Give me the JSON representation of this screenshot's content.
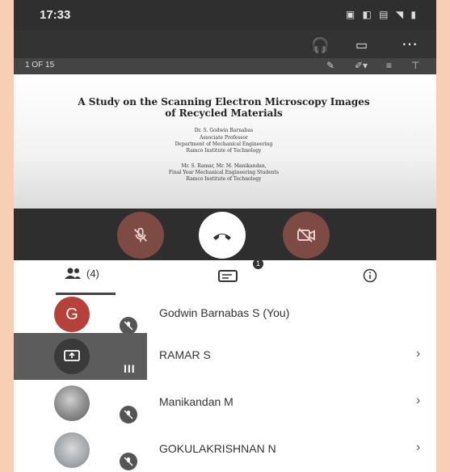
{
  "status": {
    "time": "17:33"
  },
  "presentation": {
    "page_counter": "1 OF 15",
    "title_line1": "A Study on the Scanning Electron Microscopy Images",
    "title_line2": "of Recycled Materials",
    "author_lines": [
      "Dr. S. Godwin Barnabas",
      "Associate Professor",
      "Department of Mechanical Engineering",
      "Ramco Institute of Technology",
      "Mr. S. Ramar, Mr. M. Manikandan,",
      "Final Year Mechanical Engineering Students",
      "Ramco Institute of Technology"
    ]
  },
  "tabs": {
    "people_count": "(4)",
    "chat_badge": "1"
  },
  "participants": [
    {
      "name": "Godwin Barnabas S (You)",
      "initial": "G",
      "color": "#b5413a",
      "state": "muted"
    },
    {
      "name": "RAMAR S",
      "initial": "",
      "color": "#6a6a6a",
      "state": "presenting"
    },
    {
      "name": "Manikandan M",
      "initial": "",
      "color": "#8a8a8a",
      "state": "muted"
    },
    {
      "name": "GOKULAKRISHNAN N",
      "initial": "",
      "color": "#9aa0a6",
      "state": "muted"
    }
  ]
}
